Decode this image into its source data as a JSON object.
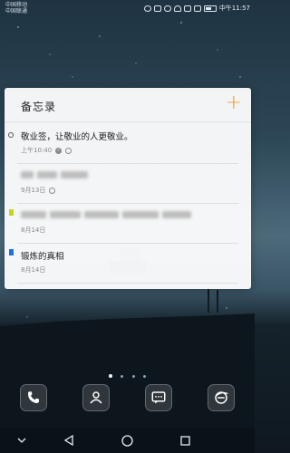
{
  "status": {
    "carrier_line1": "中国移动",
    "carrier_line2": "中国联通",
    "time_text": "中午11:57"
  },
  "widget": {
    "title": "备忘录",
    "add_icon": "plus-icon",
    "notes": [
      {
        "title": "敬业签，让敬业的人更敬业。",
        "meta": "上午10:40",
        "marker": "open-circle"
      },
      {
        "title": "",
        "meta": "9月13日",
        "marker": "none"
      },
      {
        "title": "",
        "meta": "8月14日",
        "marker": "yellow-flag"
      },
      {
        "title": "锻炼的真相",
        "meta": "8月14日",
        "marker": "blue-flag"
      }
    ]
  },
  "colors": {
    "accent_orange": "#f39a1e",
    "flag_yellow": "#c6d61a",
    "flag_blue": "#1f6fe8"
  },
  "dock": {
    "apps": [
      "phone-icon",
      "contacts-icon",
      "messages-icon",
      "browser-icon"
    ]
  },
  "navbar": {
    "buttons": [
      "collapse-chevron-icon",
      "back-icon",
      "home-icon",
      "recents-icon"
    ]
  }
}
